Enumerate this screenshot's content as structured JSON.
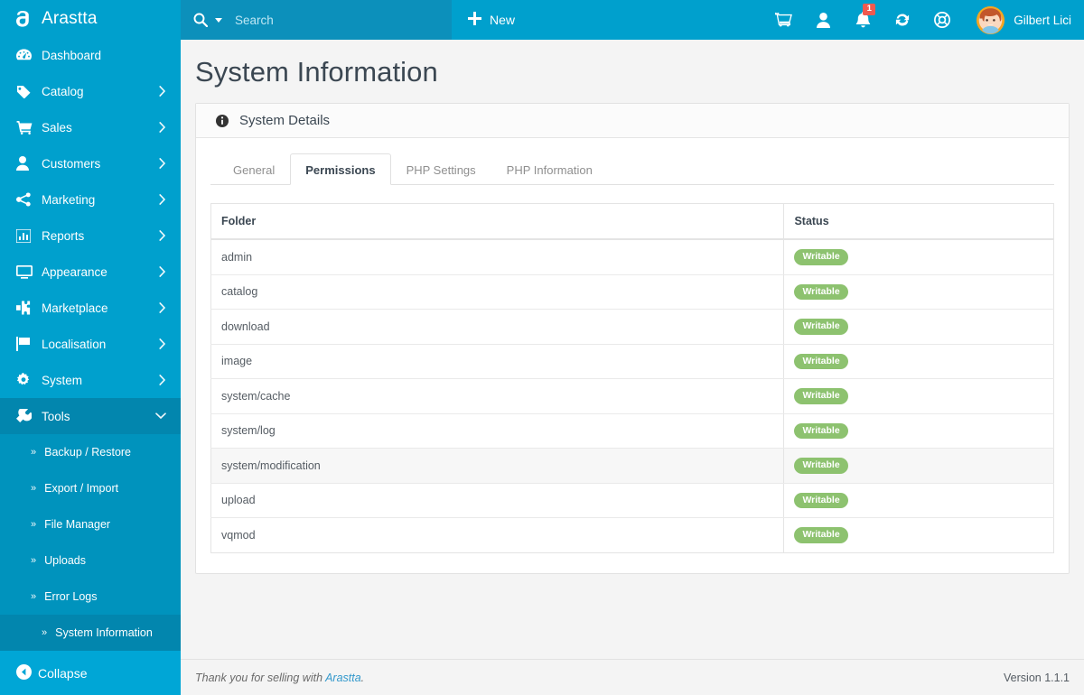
{
  "brand": {
    "name": "Arastta",
    "logo_icon": "arastta-logo-icon"
  },
  "sidebar": {
    "items": [
      {
        "label": "Dashboard",
        "icon": "dashboard-gauge-icon",
        "has_caret": false,
        "active": false
      },
      {
        "label": "Catalog",
        "icon": "tag-icon",
        "has_caret": true,
        "active": false
      },
      {
        "label": "Sales",
        "icon": "shopping-cart-icon",
        "has_caret": true,
        "active": false
      },
      {
        "label": "Customers",
        "icon": "user-icon",
        "has_caret": true,
        "active": false
      },
      {
        "label": "Marketing",
        "icon": "share-icon",
        "has_caret": true,
        "active": false
      },
      {
        "label": "Reports",
        "icon": "bar-chart-icon",
        "has_caret": true,
        "active": false
      },
      {
        "label": "Appearance",
        "icon": "monitor-icon",
        "has_caret": true,
        "active": false
      },
      {
        "label": "Marketplace",
        "icon": "puzzle-icon",
        "has_caret": true,
        "active": false
      },
      {
        "label": "Localisation",
        "icon": "flag-icon",
        "has_caret": true,
        "active": false
      },
      {
        "label": "System",
        "icon": "gear-icon",
        "has_caret": true,
        "active": false
      },
      {
        "label": "Tools",
        "icon": "wrench-icon",
        "has_caret": true,
        "active": true
      }
    ],
    "tools_submenu": [
      {
        "label": "Backup / Restore",
        "active": false
      },
      {
        "label": "Export / Import",
        "active": false
      },
      {
        "label": "File Manager",
        "active": false
      },
      {
        "label": "Uploads",
        "active": false
      },
      {
        "label": "Error Logs",
        "active": false
      },
      {
        "label": "System Information",
        "active": true
      }
    ],
    "collapse": {
      "label": "Collapse",
      "icon": "collapse-left-arrow-icon"
    }
  },
  "topbar": {
    "search": {
      "placeholder": "Search",
      "icon": "search-icon",
      "dropdown_icon": "chevron-down-icon"
    },
    "new_button": {
      "label": "New",
      "icon": "plus-icon"
    },
    "icons": [
      {
        "name": "shopping-cart-icon"
      },
      {
        "name": "user-icon"
      },
      {
        "name": "bell-icon",
        "badge": "1"
      },
      {
        "name": "refresh-icon"
      },
      {
        "name": "lifebuoy-help-icon"
      }
    ],
    "user": {
      "name": "Gilbert Lici",
      "avatar": "user-avatar"
    }
  },
  "page": {
    "title": "System Information"
  },
  "panel": {
    "title": "System Details",
    "icon": "info-circle-icon"
  },
  "tabs": [
    {
      "label": "General",
      "active": false
    },
    {
      "label": "Permissions",
      "active": true
    },
    {
      "label": "PHP Settings",
      "active": false
    },
    {
      "label": "PHP Information",
      "active": false
    }
  ],
  "table": {
    "columns": [
      "Folder",
      "Status"
    ],
    "rows": [
      {
        "folder": "admin",
        "status": "Writable",
        "hovered": false
      },
      {
        "folder": "catalog",
        "status": "Writable",
        "hovered": false
      },
      {
        "folder": "download",
        "status": "Writable",
        "hovered": false
      },
      {
        "folder": "image",
        "status": "Writable",
        "hovered": false
      },
      {
        "folder": "system/cache",
        "status": "Writable",
        "hovered": false
      },
      {
        "folder": "system/log",
        "status": "Writable",
        "hovered": false
      },
      {
        "folder": "system/modification",
        "status": "Writable",
        "hovered": true
      },
      {
        "folder": "upload",
        "status": "Writable",
        "hovered": false
      },
      {
        "folder": "vqmod",
        "status": "Writable",
        "hovered": false
      }
    ]
  },
  "footer": {
    "thanks_prefix": "Thank you for selling with ",
    "thanks_link": "Arastta",
    "thanks_suffix": ".",
    "version": "Version 1.1.1"
  },
  "colors": {
    "sidebar_blue": "#00a0cd",
    "sidebar_active": "#0286ae",
    "submenu_blue": "#0093bd",
    "search_blue": "#0c90bb",
    "collapse_blue": "#00a6d6",
    "badge_green": "#8dc26f",
    "badge_red": "#f05a50",
    "link_blue": "#3399cc",
    "page_bg": "#f4f4f4"
  }
}
